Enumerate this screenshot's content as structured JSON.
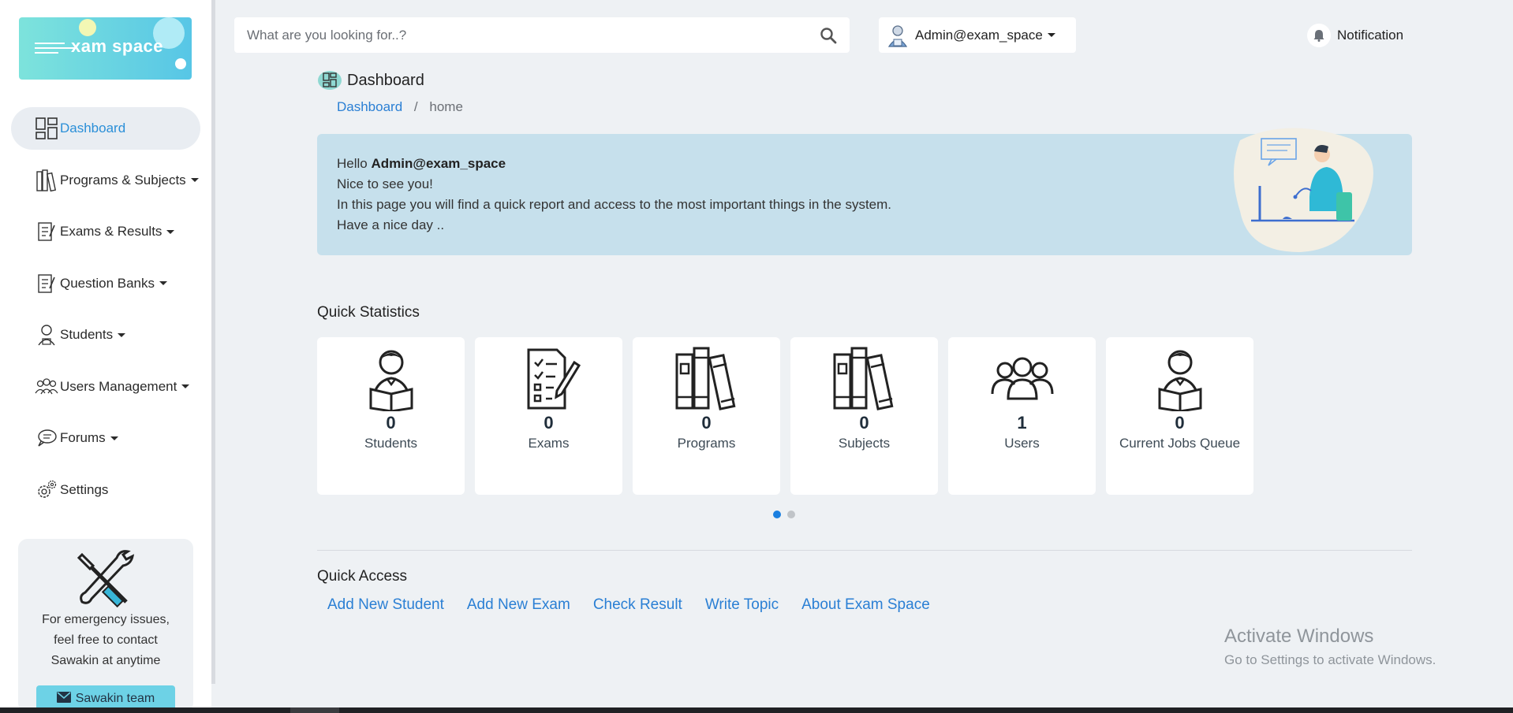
{
  "app": {
    "logo_text": "xam space"
  },
  "search": {
    "placeholder": "What are you looking for..?"
  },
  "user": {
    "name": "Admin@exam_space"
  },
  "notification": {
    "label": "Notification"
  },
  "sidebar": {
    "items": [
      {
        "label": "Dashboard",
        "icon": "dashboard-icon",
        "active": true,
        "dropdown": false
      },
      {
        "label": "Programs & Subjects",
        "icon": "books-icon",
        "dropdown": true
      },
      {
        "label": "Exams & Results",
        "icon": "exam-icon",
        "dropdown": true
      },
      {
        "label": "Question Banks",
        "icon": "question-bank-icon",
        "dropdown": true
      },
      {
        "label": "Students",
        "icon": "student-icon",
        "dropdown": true
      },
      {
        "label": "Users Management",
        "icon": "users-icon",
        "dropdown": true
      },
      {
        "label": "Forums",
        "icon": "forum-icon",
        "dropdown": true
      },
      {
        "label": "Settings",
        "icon": "gear-icon",
        "dropdown": false
      }
    ],
    "help": {
      "text_line1": "For emergency issues,",
      "text_line2": "feel free to contact",
      "text_line3": "Sawakin at anytime",
      "button_label": "Sawakin team"
    }
  },
  "page": {
    "title": "Dashboard",
    "breadcrumb": {
      "link": "Dashboard",
      "current": "home"
    }
  },
  "welcome": {
    "hello": "Hello",
    "user": "Admin@exam_space",
    "line1": "Nice to see you!",
    "line2": "In this page you will find a quick report and access to the most important things in the system.",
    "line3": "Have a nice day .."
  },
  "quick_statistics": {
    "title": "Quick Statistics",
    "cards": [
      {
        "value": "0",
        "label": "Students",
        "icon": "student-reading-icon"
      },
      {
        "value": "0",
        "label": "Exams",
        "icon": "exam-checklist-icon"
      },
      {
        "value": "0",
        "label": "Programs",
        "icon": "books-icon"
      },
      {
        "value": "0",
        "label": "Subjects",
        "icon": "books-icon"
      },
      {
        "value": "1",
        "label": "Users",
        "icon": "users-group-icon"
      },
      {
        "value": "0",
        "label": "Current Jobs Queue",
        "icon": "student-reading-icon"
      }
    ]
  },
  "quick_access": {
    "title": "Quick Access",
    "links": [
      "Add New Student",
      "Add New Exam",
      "Check Result",
      "Write Topic",
      "About Exam Space"
    ]
  },
  "watermark": {
    "title": "Activate Windows",
    "subtitle": "Go to Settings to activate Windows."
  },
  "colors": {
    "accent": "#2a7fd4",
    "welcome_bg": "#c6e0ec",
    "logo_teal": "#57c6e6"
  }
}
